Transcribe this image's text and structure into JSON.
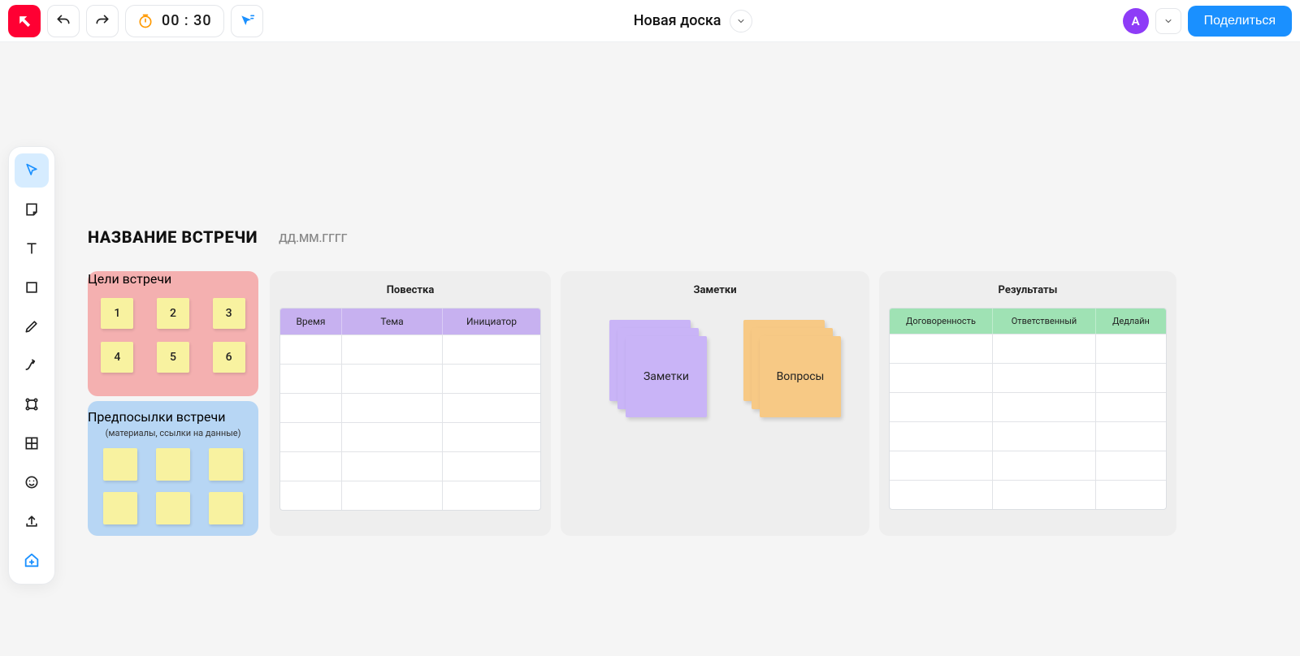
{
  "header": {
    "timer": "00 : 30",
    "board_title": "Новая доска",
    "avatar_initial": "A",
    "share_label": "Поделиться"
  },
  "canvas": {
    "meeting_title": "НАЗВАНИЕ ВСТРЕЧИ",
    "meeting_date_placeholder": "ДД.ММ.ГГГГ",
    "goals": {
      "title": "Цели встречи",
      "stickies": [
        "1",
        "2",
        "3",
        "4",
        "5",
        "6"
      ]
    },
    "prereq": {
      "title": "Предпосылки встречи",
      "subtitle": "(материалы, ссылки на данные)"
    },
    "agenda": {
      "title": "Повестка",
      "columns": [
        "Время",
        "Тема",
        "Инициатор"
      ]
    },
    "notes": {
      "title": "Заметки",
      "stack_notes_label": "Заметки",
      "stack_questions_label": "Вопросы"
    },
    "results": {
      "title": "Результаты",
      "columns": [
        "Договоренность",
        "Ответственный",
        "Дедлайн"
      ]
    }
  }
}
